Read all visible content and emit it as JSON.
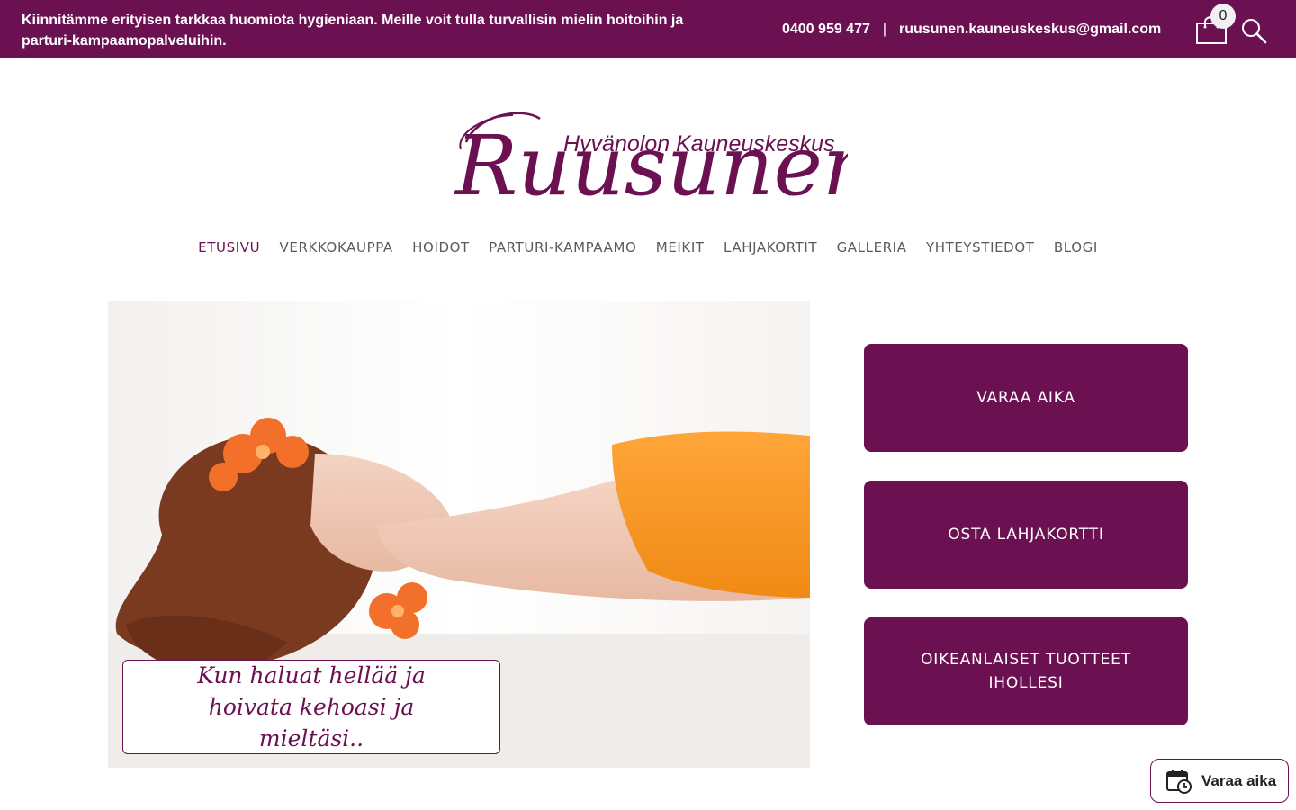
{
  "topbar": {
    "notice": "Kiinnitämme erityisen tarkkaa huomiota hygieniaan. Meille voit tulla turvallisin mielin hoitoihin ja parturi-kampaamopalveluihin.",
    "phone": "0400 959 477",
    "separator": "|",
    "email": "ruusunen.kauneuskeskus@gmail.com",
    "cart_count": "0",
    "cart_icon": "shopping-bag-icon",
    "search_icon": "search-icon"
  },
  "logo": {
    "tagline": "Hyvänolon Kauneuskeskus",
    "name": "Ruusunen"
  },
  "nav": {
    "items": [
      {
        "label": "ETUSIVU",
        "active": true
      },
      {
        "label": "VERKKOKAUPPA"
      },
      {
        "label": "HOIDOT"
      },
      {
        "label": "PARTURI-KAMPAAMO"
      },
      {
        "label": "MEIKIT"
      },
      {
        "label": "LAHJAKORTIT"
      },
      {
        "label": "GALLERIA"
      },
      {
        "label": "YHTEYSTIEDOT"
      },
      {
        "label": "BLOGI"
      }
    ]
  },
  "hero": {
    "caption": "Kun haluat hellää ja hoivata kehoasi ja mieltäsi.."
  },
  "cta": {
    "book": "VARAA AIKA",
    "giftcard": "OSTA LAHJAKORTTI",
    "products": "OIKEANLAISET TUOTTEET IHOLLESI"
  },
  "floating": {
    "label": "Varaa aika",
    "icon": "calendar-clock-icon"
  },
  "colors": {
    "brand": "#6b1152",
    "white": "#ffffff"
  }
}
